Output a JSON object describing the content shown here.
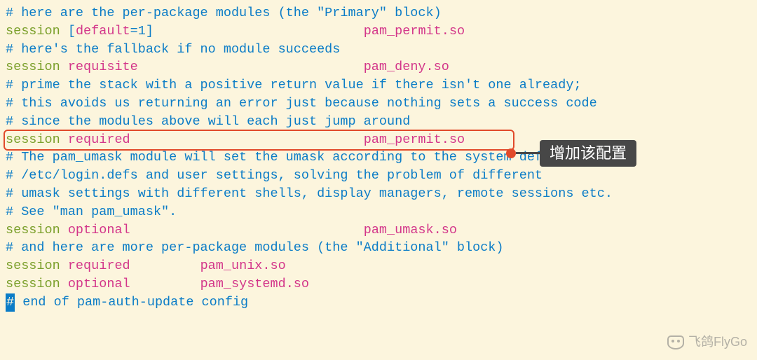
{
  "lines": {
    "c1": "# here are the per-package modules (the \"Primary\" block)",
    "l2": {
      "s": "session",
      "b1": "[",
      "d": "default",
      "e": "=",
      "o": "1",
      "b2": "]",
      "pad": "                           ",
      "m": "pam_permit.so"
    },
    "c3": "# here's the fallback if no module succeeds",
    "l4": {
      "s": "session",
      "ctl": "requisite",
      "pad": "                             ",
      "m": "pam_deny.so"
    },
    "c5": "# prime the stack with a positive return value if there isn't one already;",
    "c6": "# this avoids us returning an error just because nothing sets a success code",
    "c7": "# since the modules above will each just jump around",
    "l8": {
      "s": "session",
      "ctl": "required",
      "pad": "                              ",
      "m": "pam_permit.so"
    },
    "c9": "# The pam_umask module will set the umask according to the system default in",
    "c10": "# /etc/login.defs and user settings, solving the problem of different",
    "c11": "# umask settings with different shells, display managers, remote sessions etc.",
    "c12": "# See \"man pam_umask\".",
    "l13": {
      "s": "session",
      "ctl": "optional",
      "pad": "                              ",
      "m": "pam_umask.so"
    },
    "c14": "# and here are more per-package modules (the \"Additional\" block)",
    "l15": {
      "s": "session",
      "ctl": "required",
      "pad": "         ",
      "m": "pam_unix.so"
    },
    "l16": {
      "s": "session",
      "ctl": "optional",
      "pad": "         ",
      "m": "pam_systemd.so"
    },
    "l17": {
      "cur": "#",
      "rest": " end of pam-auth-update config"
    }
  },
  "callout": "增加该配置",
  "watermark": "飞鸽FlyGo"
}
